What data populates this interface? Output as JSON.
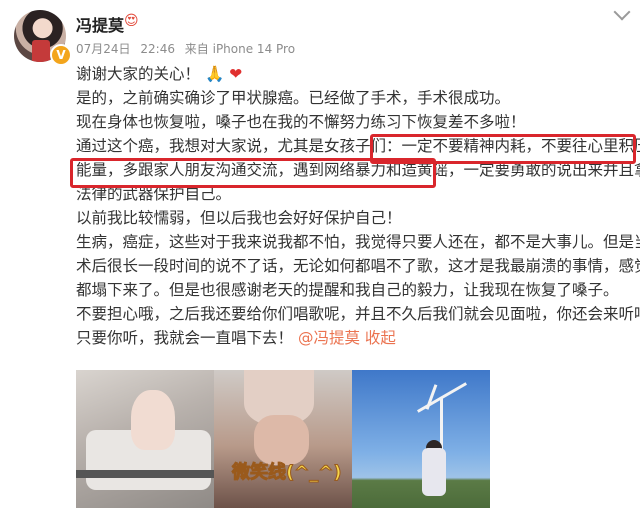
{
  "author": {
    "name": "冯提莫",
    "name_emoji": "😍",
    "verified_badge": "V"
  },
  "meta": {
    "date": "07月24日",
    "time": "22:46",
    "source": "来自 iPhone 14 Pro"
  },
  "post": {
    "line1": "谢谢大家的关心！",
    "line1_emoji_1": "🙏",
    "line1_emoji_2": "❤",
    "para2": "是的，之前确实确诊了甲状腺癌。已经做了手术，手术很成功。",
    "para3": "现在身体也恢复啦，嗓子也在我的不懈努力练习下恢复差不多啦！",
    "para4_a": "通过这个癌，我想对大家说，尤其是女孩子们：",
    "para4_b": "一定不要精神内耗，不要往心里积压负",
    "para4_c": "能量，多跟家人朋友沟通交流，遇到网络暴力和造黄谣，",
    "para4_d": "一定要勇敢的说出来并且拿起",
    "para4_e": "法律的武器保护自己。",
    "para5": "以前我比较懦弱，但以后我也会好好保护自己！",
    "para6_a": "生病，癌症，这些对于我来说我都不怕，我觉得只要人还在，都不是大事儿。但是当我",
    "para6_b": "术后很长一段时间的说不了话，无论如何都唱不了歌，这才是我最崩溃的事情，感觉天",
    "para6_c": "都塌下来了。但是也很感谢老天的提醒和我自己的毅力，让我现在恢复了嗓子。",
    "para7_a": "不要担心哦，之后我还要给你们唱歌呢，并且不久后我们就会见面啦，你还会来听吗？",
    "para7_b": "只要你听，我就会一直唱下去！",
    "location_tag": "冯提莫 收起",
    "location_icon": "@"
  },
  "photos": {
    "photo2_caption": "微笑线(^_^)"
  },
  "colors": {
    "highlight_border": "#d9262c",
    "link": "#eb7350",
    "meta_gray": "#8c8c8c"
  }
}
